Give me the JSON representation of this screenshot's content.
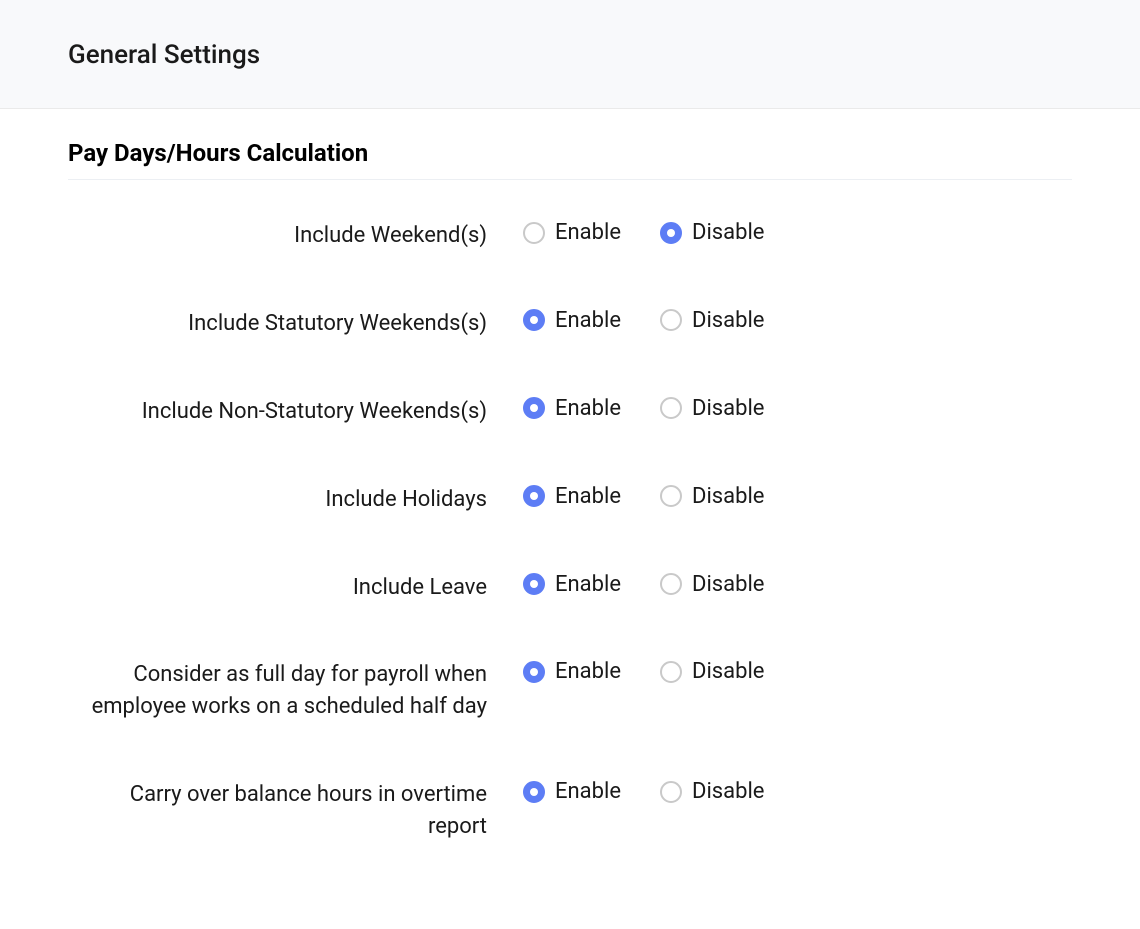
{
  "header": {
    "title": "General Settings"
  },
  "section": {
    "title": "Pay Days/Hours Calculation"
  },
  "options": {
    "enable": "Enable",
    "disable": "Disable"
  },
  "settings": [
    {
      "label": "Include Weekend(s)",
      "selected": "disable"
    },
    {
      "label": "Include Statutory Weekends(s)",
      "selected": "enable"
    },
    {
      "label": "Include Non-Statutory Weekends(s)",
      "selected": "enable"
    },
    {
      "label": "Include Holidays",
      "selected": "enable"
    },
    {
      "label": "Include Leave",
      "selected": "enable"
    },
    {
      "label": "Consider as full day for payroll when employee works on a scheduled half day",
      "selected": "enable"
    },
    {
      "label": "Carry over balance hours in overtime report",
      "selected": "enable"
    }
  ]
}
